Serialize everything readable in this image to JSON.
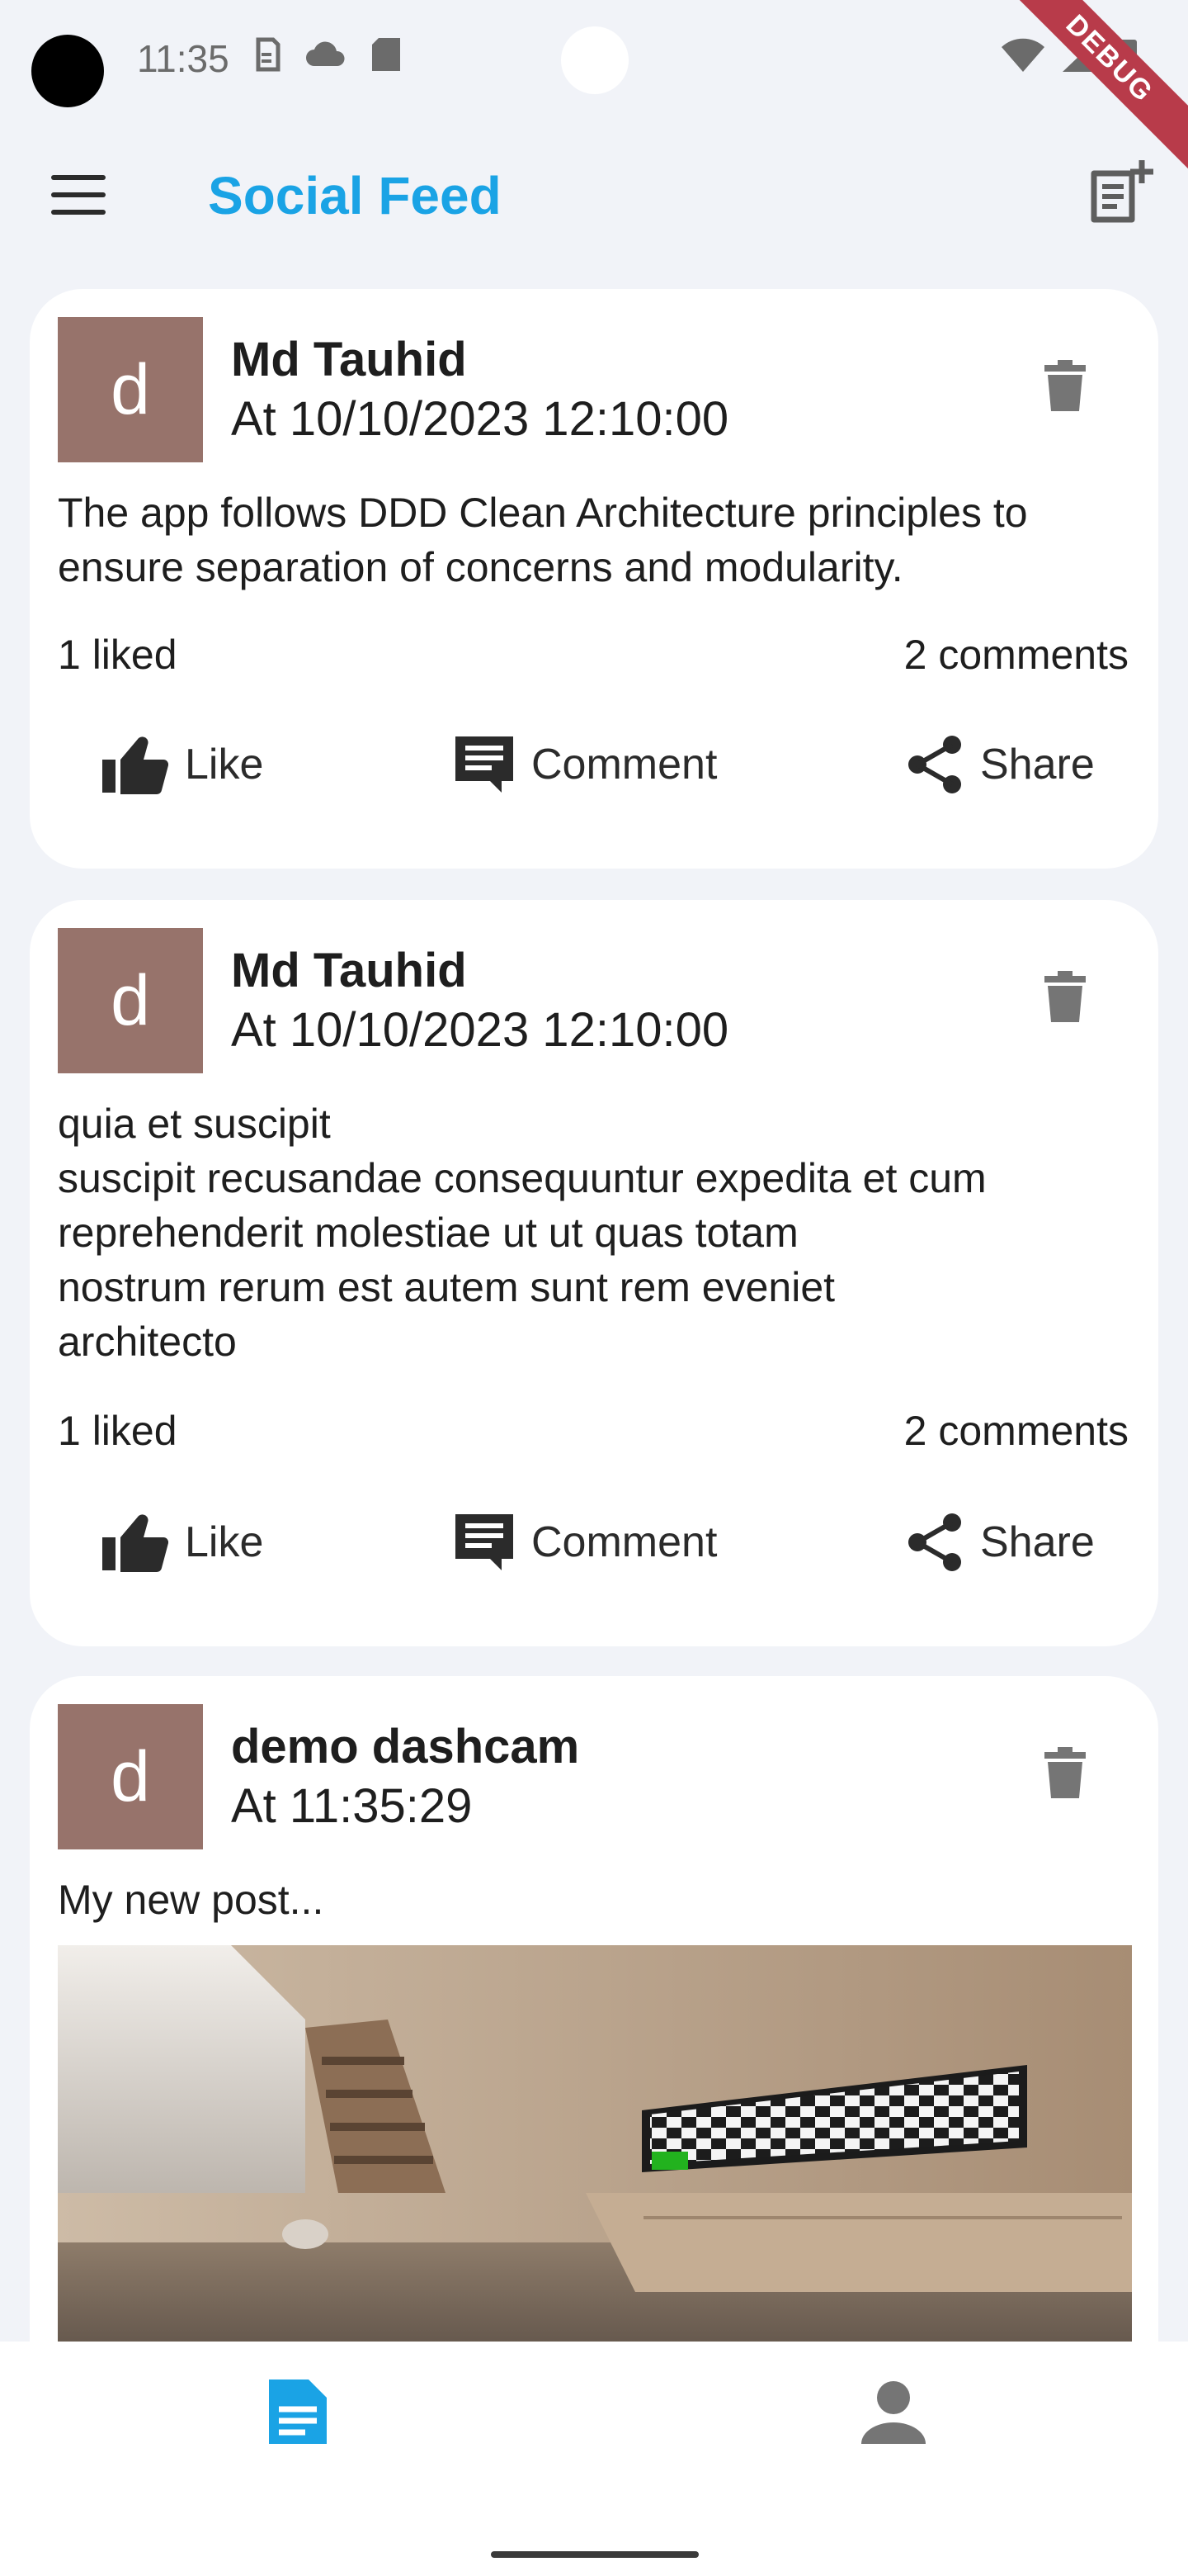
{
  "status_bar": {
    "time": "11:35"
  },
  "debug_banner": "DEBUG",
  "app_bar": {
    "title": "Social Feed"
  },
  "posts": [
    {
      "avatar_letter": "d",
      "author": "Md Tauhid",
      "time": "At 10/10/2023 12:10:00",
      "body": "The app follows DDD Clean Architecture principles to ensure separation of concerns and modularity.",
      "likes": "1 liked",
      "comments": "2 comments"
    },
    {
      "avatar_letter": "d",
      "author": "Md Tauhid",
      "time": "At 10/10/2023 12:10:00",
      "body": "quia et suscipit\nsuscipit recusandae consequuntur expedita et cum\nreprehenderit molestiae ut ut quas totam\nnostrum rerum est autem sunt rem eveniet\narchitecto",
      "likes": "1 liked",
      "comments": "2 comments"
    },
    {
      "avatar_letter": "d",
      "author": "demo dashcam",
      "time": "At 11:35:29",
      "body": "My new post..."
    }
  ],
  "actions": {
    "like": "Like",
    "comment": "Comment",
    "share": "Share"
  },
  "colors": {
    "accent": "#1AA3E5",
    "avatar_bg": "#97736B",
    "background": "#F1F3F8",
    "icon_gray": "#757575"
  },
  "bottom_nav": {
    "items": [
      "feed-icon",
      "profile-icon"
    ],
    "active": "feed-icon"
  }
}
